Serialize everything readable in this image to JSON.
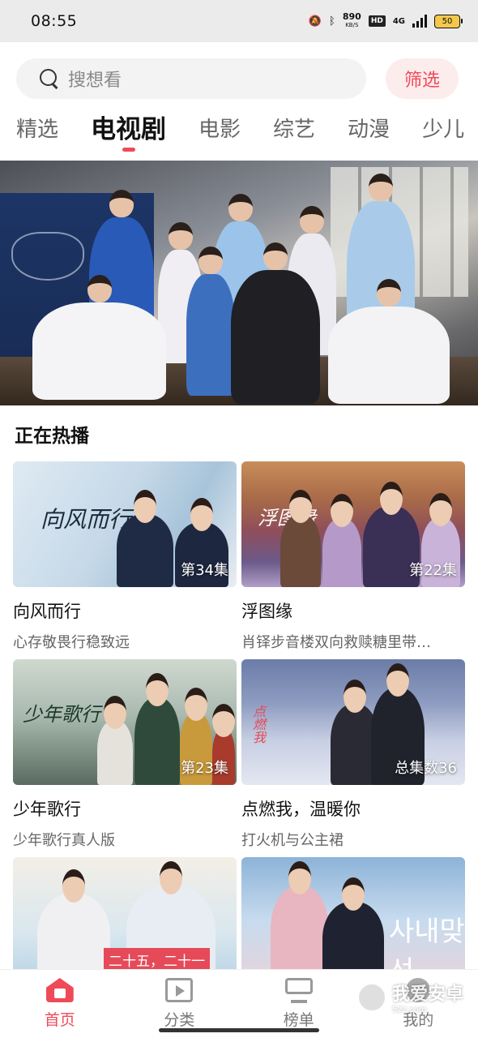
{
  "status_bar": {
    "time": "08:55",
    "net_speed_value": "890",
    "net_speed_unit": "KB/S",
    "hd_badge": "HD",
    "network": "4G",
    "battery": "50"
  },
  "search": {
    "placeholder": "搜想看",
    "filter_label": "筛选"
  },
  "tabs": [
    {
      "label": "精选",
      "active": false
    },
    {
      "label": "电视剧",
      "active": true
    },
    {
      "label": "电影",
      "active": false
    },
    {
      "label": "综艺",
      "active": false
    },
    {
      "label": "动漫",
      "active": false
    },
    {
      "label": "少儿",
      "active": false
    }
  ],
  "section": {
    "title": "正在热播"
  },
  "cards": [
    {
      "title": "向风而行",
      "subtitle": "心存敬畏行稳致远",
      "badge": "第34集",
      "poster_text": "向风而行"
    },
    {
      "title": "浮图缘",
      "subtitle": "肖铎步音楼双向救赎糖里带…",
      "badge": "第22集",
      "poster_text": "浮图缘"
    },
    {
      "title": "少年歌行",
      "subtitle": "少年歌行真人版",
      "badge": "第23集",
      "poster_text": "少年歌行"
    },
    {
      "title": "点燃我，温暖你",
      "subtitle": "打火机与公主裙",
      "badge": "总集数36",
      "poster_text": "点燃我"
    },
    {
      "title": "",
      "subtitle": "",
      "badge": "",
      "poster_text": "二十五，二十一"
    },
    {
      "title": "",
      "subtitle": "",
      "badge": "",
      "poster_text": "사내맞선"
    }
  ],
  "bottom_nav": [
    {
      "label": "首页",
      "icon": "home-icon",
      "active": true
    },
    {
      "label": "分类",
      "icon": "category-icon",
      "active": false
    },
    {
      "label": "榜单",
      "icon": "rank-icon",
      "active": false
    },
    {
      "label": "我的",
      "icon": "mine-icon",
      "active": false
    }
  ],
  "watermark": {
    "text": "我爱安卓",
    "url_text": "52z.com"
  },
  "colors": {
    "accent": "#ef4a58",
    "status_bar_bg": "#ebebeb"
  }
}
